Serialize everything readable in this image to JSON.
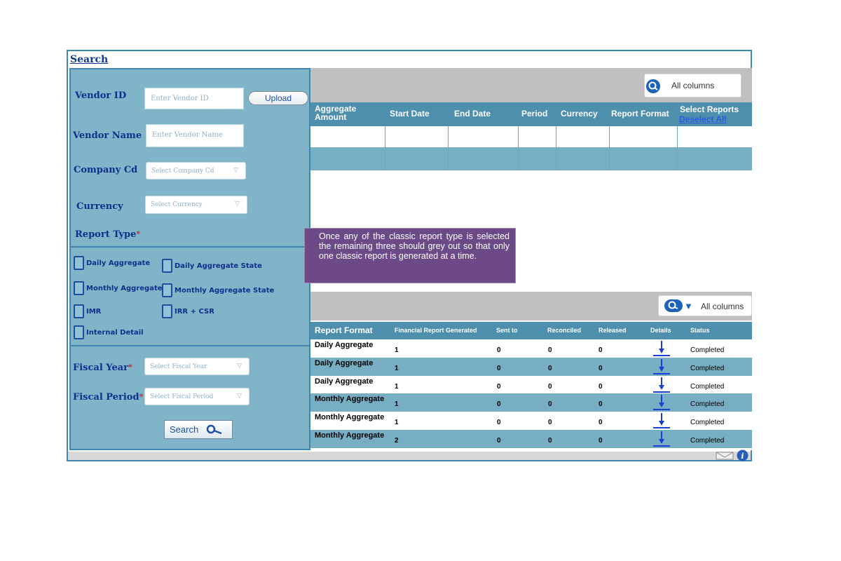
{
  "header": {
    "search_link": "Search"
  },
  "form": {
    "vendor_id": {
      "label": "Vendor ID",
      "placeholder": "Enter Vendor ID"
    },
    "upload_label": "Upload",
    "vendor_name": {
      "label": "Vendor Name",
      "placeholder": "Enter Vendor Name"
    },
    "company_cd": {
      "label": "Company Cd",
      "placeholder": "Select Company Cd"
    },
    "currency": {
      "label": "Currency",
      "placeholder": "Select Currency"
    },
    "report_type_label": "Report Type",
    "required_mark": "*",
    "report_types": [
      "Daily Aggregate",
      "Daily Aggregate State",
      "Monthly Aggregate",
      "Monthly Aggregate State",
      "IMR",
      "IRR + CSR",
      "Internal Detail"
    ],
    "fiscal_year": {
      "label": "Fiscal Year",
      "placeholder": "Select Fiscal Year"
    },
    "fiscal_period": {
      "label": "Fiscal Period",
      "placeholder": "Select Fiscal Period"
    },
    "search_button": "Search"
  },
  "top_table": {
    "search_label": "All columns",
    "columns": [
      "Aggregate Amount",
      "Start Date",
      "End Date",
      "Period",
      "Currency",
      "Report Format",
      "Select Reports"
    ],
    "deselect_all": "Deselect All"
  },
  "note": "Once any of the classic report type is selected the remaining three should grey out so that only one classic report is generated at a time.",
  "bottom_table": {
    "search_label": "All columns",
    "columns": [
      "Report Format",
      "Financial Report Generated",
      "Sent to",
      "Reconciled",
      "Released",
      "Details",
      "Status"
    ],
    "rows": [
      {
        "format": "Daily Aggregate",
        "generated": "1",
        "sent": "0",
        "reconciled": "0",
        "released": "0",
        "status": "Completed"
      },
      {
        "format": "Daily Aggregate",
        "generated": "1",
        "sent": "0",
        "reconciled": "0",
        "released": "0",
        "status": "Completed"
      },
      {
        "format": "Daily Aggregate",
        "generated": "1",
        "sent": "0",
        "reconciled": "0",
        "released": "0",
        "status": "Completed"
      },
      {
        "format": "Monthly Aggregate",
        "generated": "1",
        "sent": "0",
        "reconciled": "0",
        "released": "0",
        "status": "Completed"
      },
      {
        "format": "Monthly Aggregate",
        "generated": "1",
        "sent": "0",
        "reconciled": "0",
        "released": "0",
        "status": "Completed"
      },
      {
        "format": "Monthly Aggregate",
        "generated": "2",
        "sent": "0",
        "reconciled": "0",
        "released": "0",
        "status": "Completed"
      }
    ]
  },
  "icons": {
    "search": "search-icon",
    "download": "download-icon",
    "mail": "mail-icon",
    "info": "info-icon"
  },
  "colors": {
    "panel": "#80b4c9",
    "header": "#4f8fae",
    "note": "#6b4a87",
    "label": "#0e2f8a"
  }
}
